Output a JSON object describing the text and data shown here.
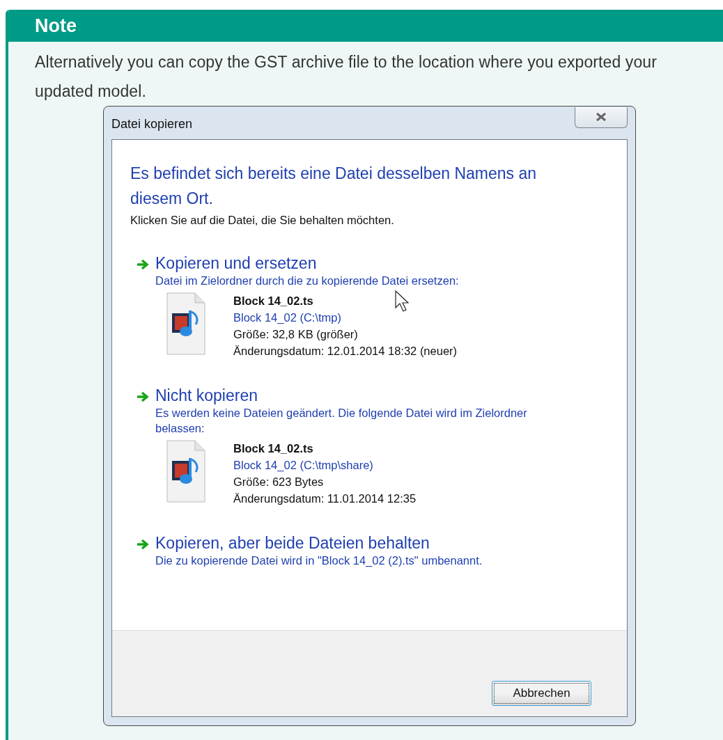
{
  "note": {
    "title": "Note",
    "text": "Alternatively you can copy the GST archive file to the location where you exported your updated model."
  },
  "dialog": {
    "title": "Datei kopieren",
    "heading": "Es befindet sich bereits eine Datei desselben Namens an diesem Ort.",
    "instruction": "Klicken Sie auf die Datei, die Sie behalten möchten.",
    "options": [
      {
        "title": "Kopieren und ersetzen",
        "description": "Datei im Zielordner durch die zu kopierende Datei ersetzen:",
        "file": {
          "name": "Block 14_02.ts",
          "location": "Block 14_02 (C:\\tmp)",
          "size": "Größe: 32,8 KB (größer)",
          "date": "Änderungsdatum: 12.01.2014 18:32 (neuer)"
        }
      },
      {
        "title": "Nicht kopieren",
        "description": "Es werden keine Dateien geändert. Die folgende Datei wird im Zielordner belassen:",
        "file": {
          "name": "Block 14_02.ts",
          "location": "Block 14_02 (C:\\tmp\\share)",
          "size": "Größe: 623 Bytes",
          "date": "Änderungsdatum: 11.01.2014 12:35"
        }
      },
      {
        "title": "Kopieren, aber beide Dateien behalten",
        "description": "Die zu kopierende Datei wird in \"Block 14_02 (2).ts\" umbenannt."
      }
    ],
    "buttons": [
      "Abbrechen"
    ]
  }
}
